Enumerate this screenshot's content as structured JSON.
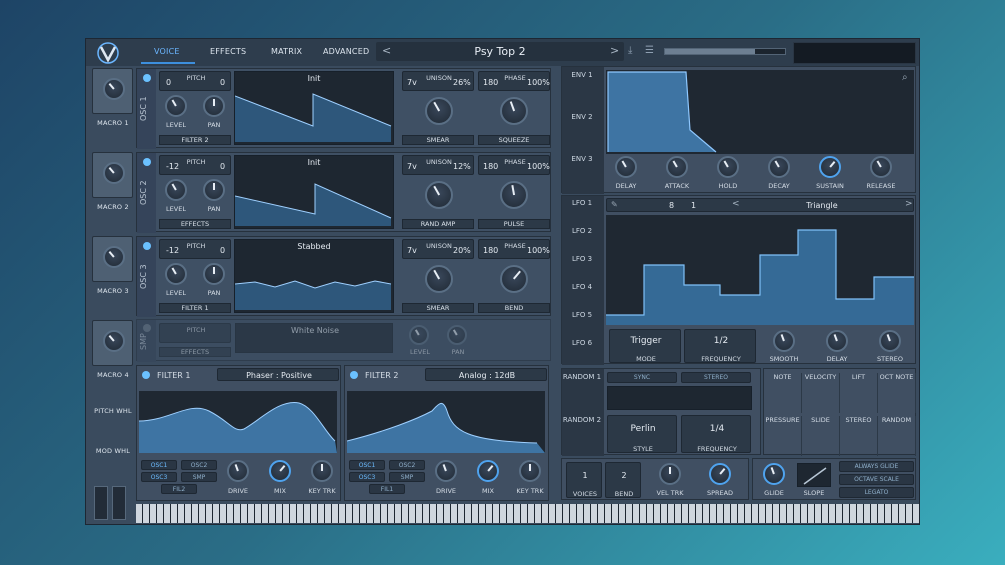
{
  "header": {
    "tabs": [
      "VOICE",
      "EFFECTS",
      "MATRIX",
      "ADVANCED"
    ],
    "preset": "Psy Top 2"
  },
  "macros": [
    "MACRO 1",
    "MACRO 2",
    "MACRO 3",
    "MACRO 4"
  ],
  "side_labels": {
    "pitch_wheel": "PITCH WHL",
    "mod_wheel": "MOD WHL"
  },
  "oscs": [
    {
      "label": "OSC 1",
      "pitch_l": "0",
      "pitch_r": "0",
      "pitch": "PITCH",
      "wave": "Init",
      "unison_v": "7v",
      "unison_pct": "26%",
      "phase": "180",
      "phase_pct": "100%",
      "k1": "SMEAR",
      "k2": "SQUEEZE",
      "dest": "FILTER 2",
      "level": "LEVEL",
      "pan": "PAN",
      "unison": "UNISON",
      "phase_lbl": "PHASE"
    },
    {
      "label": "OSC 2",
      "pitch_l": "-12",
      "pitch_r": "0",
      "pitch": "PITCH",
      "wave": "Init",
      "unison_v": "7v",
      "unison_pct": "12%",
      "phase": "180",
      "phase_pct": "100%",
      "k1": "RAND AMP",
      "k2": "PULSE",
      "dest": "EFFECTS",
      "level": "LEVEL",
      "pan": "PAN",
      "unison": "UNISON",
      "phase_lbl": "PHASE"
    },
    {
      "label": "OSC 3",
      "pitch_l": "-12",
      "pitch_r": "0",
      "pitch": "PITCH",
      "wave": "Stabbed",
      "unison_v": "7v",
      "unison_pct": "20%",
      "phase": "180",
      "phase_pct": "100%",
      "k1": "SMEAR",
      "k2": "BEND",
      "dest": "FILTER 1",
      "level": "LEVEL",
      "pan": "PAN",
      "unison": "UNISON",
      "phase_lbl": "PHASE"
    }
  ],
  "noise": {
    "label": "SMP",
    "pitch": "PITCH",
    "wave": "White Noise",
    "dest": "EFFECTS",
    "level": "LEVEL",
    "pan": "PAN"
  },
  "filters": [
    {
      "label": "FILTER 1",
      "style": "Phaser : Positive",
      "srcs": [
        "OSC1",
        "OSC2",
        "OSC3",
        "SMP",
        "FIL2"
      ],
      "knobs": [
        "DRIVE",
        "MIX",
        "KEY TRK"
      ]
    },
    {
      "label": "FILTER 2",
      "style": "Analog : 12dB",
      "srcs": [
        "OSC1",
        "OSC2",
        "OSC3",
        "SMP",
        "FIL1"
      ],
      "knobs": [
        "DRIVE",
        "MIX",
        "KEY TRK"
      ]
    }
  ],
  "env": {
    "tabs": [
      "ENV 1",
      "ENV 2",
      "ENV 3"
    ],
    "knobs": [
      "DELAY",
      "ATTACK",
      "HOLD",
      "DECAY",
      "SUSTAIN",
      "RELEASE"
    ]
  },
  "lfo": {
    "tabs": [
      "LFO 1",
      "LFO 2",
      "LFO 3",
      "LFO 4",
      "LFO 5",
      "LFO 6"
    ],
    "rate_l": "8",
    "rate_r": "1",
    "shape": "Triangle",
    "trigger": "Trigger",
    "mode": "MODE",
    "freq_val": "1/2",
    "freq": "FREQUENCY",
    "k": [
      "SMOOTH",
      "DELAY",
      "STEREO"
    ]
  },
  "random": {
    "tabs": [
      "RANDOM 1",
      "RANDOM 2"
    ],
    "sync": "SYNC",
    "stereo": "STEREO",
    "style_val": "Perlin",
    "style": "STYLE",
    "freq_val": "1/4",
    "freq": "FREQUENCY"
  },
  "mods": [
    "NOTE",
    "VELOCITY",
    "LIFT",
    "OCT NOTE",
    "PRESSURE",
    "SLIDE",
    "STEREO",
    "RANDOM"
  ],
  "voice": {
    "voices": "1",
    "voices_lbl": "VOICES",
    "bend": "2",
    "bend_lbl": "BEND",
    "vel": "VEL TRK",
    "spread": "SPREAD",
    "glide": "GLIDE",
    "slope": "SLOPE",
    "opts": [
      "ALWAYS GLIDE",
      "OCTAVE SCALE",
      "LEGATO"
    ]
  }
}
